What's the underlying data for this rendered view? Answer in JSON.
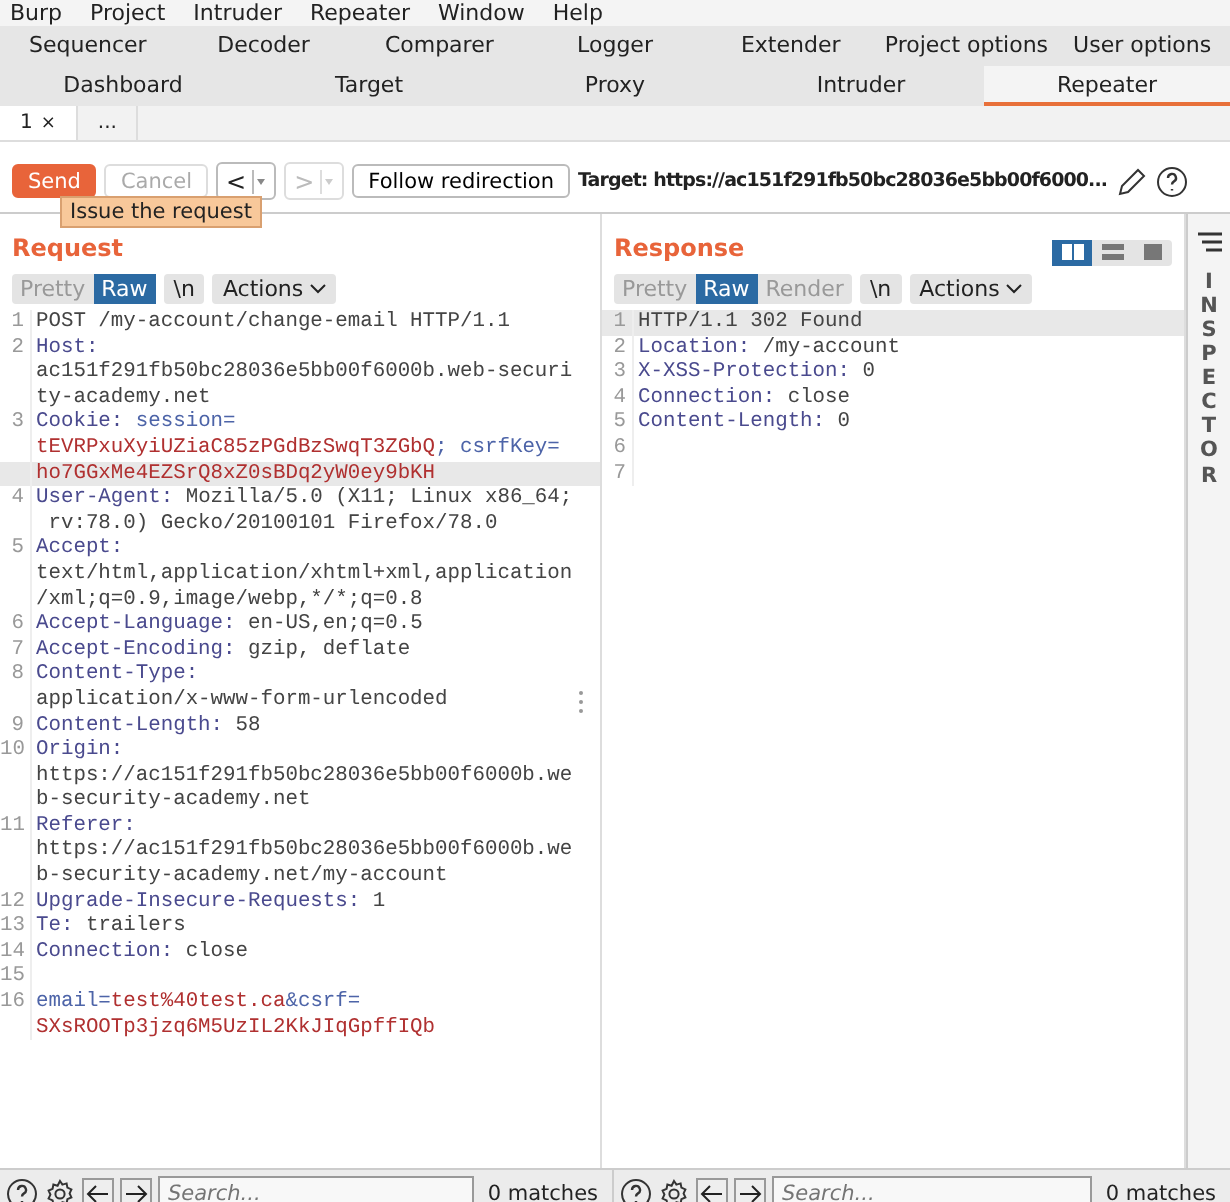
{
  "menu": [
    "Burp",
    "Project",
    "Intruder",
    "Repeater",
    "Window",
    "Help"
  ],
  "tabs_row_1": [
    {
      "label": "Sequencer",
      "selected": false
    },
    {
      "label": "Decoder",
      "selected": false
    },
    {
      "label": "Comparer",
      "selected": false
    },
    {
      "label": "Logger",
      "selected": false
    },
    {
      "label": "Extender",
      "selected": false
    },
    {
      "label": "Project options",
      "selected": false
    },
    {
      "label": "User options",
      "selected": false
    }
  ],
  "tabs_row_2": [
    {
      "label": "Dashboard",
      "selected": false
    },
    {
      "label": "Target",
      "selected": false
    },
    {
      "label": "Proxy",
      "selected": false
    },
    {
      "label": "Intruder",
      "selected": false
    },
    {
      "label": "Repeater",
      "selected": true
    }
  ],
  "repeater_tabs": [
    {
      "label": "1",
      "close": "×",
      "selected": true
    },
    {
      "label": "...",
      "selected": false
    }
  ],
  "toolbar": {
    "send": "Send",
    "cancel": "Cancel",
    "back": "<",
    "forward": ">",
    "follow": "Follow redirection",
    "target": "Target: https://ac151f291fb50bc28036e5bb00f6000...",
    "tooltip": "Issue the request"
  },
  "request": {
    "title": "Request",
    "views": [
      {
        "label": "Pretty",
        "selected": false
      },
      {
        "label": "Raw",
        "selected": true
      }
    ],
    "newline": "\\n",
    "actions": "Actions",
    "lines": [
      {
        "number": "1",
        "highlighted": false,
        "rows": [
          {
            "parts": [
              {
                "text": "POST /my-account/change-email HTTP/1.1",
                "kind": "plain"
              }
            ]
          }
        ]
      },
      {
        "number": "2",
        "highlighted": false,
        "rows": [
          {
            "parts": [
              {
                "text": "Host:",
                "kind": "key"
              }
            ]
          },
          {
            "parts": [
              {
                "text": "ac151f291fb50bc28036e5bb00f6000b.web-securi",
                "kind": "plain"
              }
            ]
          },
          {
            "parts": [
              {
                "text": "ty-academy.net",
                "kind": "plain"
              }
            ]
          }
        ]
      },
      {
        "number": "3",
        "highlighted": true,
        "rows": [
          {
            "parts": [
              {
                "text": "Cookie:",
                "kind": "key"
              },
              {
                "text": " session=",
                "kind": "param"
              }
            ]
          },
          {
            "parts": [
              {
                "text": "tEVRPxuXyiUZiaC85zPGdBzSwqT3ZGbQ",
                "kind": "value"
              },
              {
                "text": "; csrfKey=",
                "kind": "param"
              }
            ]
          },
          {
            "parts": [
              {
                "text": "ho7GGxMe4EZSrQ8xZ0sBDq2yW0ey9bKH",
                "kind": "value"
              }
            ]
          }
        ]
      },
      {
        "number": "4",
        "highlighted": false,
        "rows": [
          {
            "parts": [
              {
                "text": "User-Agent:",
                "kind": "key"
              },
              {
                "text": " Mozilla/5.0 (X11; Linux x86_64;",
                "kind": "plain"
              }
            ]
          },
          {
            "parts": [
              {
                "text": " rv:78.0) Gecko/20100101 Firefox/78.0",
                "kind": "plain"
              }
            ]
          }
        ]
      },
      {
        "number": "5",
        "highlighted": false,
        "rows": [
          {
            "parts": [
              {
                "text": "Accept:",
                "kind": "key"
              }
            ]
          },
          {
            "parts": [
              {
                "text": "text/html,application/xhtml+xml,application",
                "kind": "plain"
              }
            ]
          },
          {
            "parts": [
              {
                "text": "/xml;q=0.9,image/webp,*/*;q=0.8",
                "kind": "plain"
              }
            ]
          }
        ]
      },
      {
        "number": "6",
        "highlighted": false,
        "rows": [
          {
            "parts": [
              {
                "text": "Accept-Language:",
                "kind": "key"
              },
              {
                "text": " en-US,en;q=0.5",
                "kind": "plain"
              }
            ]
          }
        ]
      },
      {
        "number": "7",
        "highlighted": false,
        "rows": [
          {
            "parts": [
              {
                "text": "Accept-Encoding:",
                "kind": "key"
              },
              {
                "text": " gzip, deflate",
                "kind": "plain"
              }
            ]
          }
        ]
      },
      {
        "number": "8",
        "highlighted": false,
        "rows": [
          {
            "parts": [
              {
                "text": "Content-Type:",
                "kind": "key"
              }
            ]
          },
          {
            "parts": [
              {
                "text": "application/x-www-form-urlencoded",
                "kind": "plain"
              }
            ]
          }
        ]
      },
      {
        "number": "9",
        "highlighted": false,
        "rows": [
          {
            "parts": [
              {
                "text": "Content-Length:",
                "kind": "key"
              },
              {
                "text": " 58",
                "kind": "plain"
              }
            ]
          }
        ]
      },
      {
        "number": "10",
        "highlighted": false,
        "rows": [
          {
            "parts": [
              {
                "text": "Origin:",
                "kind": "key"
              }
            ]
          },
          {
            "parts": [
              {
                "text": "https://ac151f291fb50bc28036e5bb00f6000b.we",
                "kind": "plain"
              }
            ]
          },
          {
            "parts": [
              {
                "text": "b-security-academy.net",
                "kind": "plain"
              }
            ]
          }
        ]
      },
      {
        "number": "11",
        "highlighted": false,
        "rows": [
          {
            "parts": [
              {
                "text": "Referer:",
                "kind": "key"
              }
            ]
          },
          {
            "parts": [
              {
                "text": "https://ac151f291fb50bc28036e5bb00f6000b.we",
                "kind": "plain"
              }
            ]
          },
          {
            "parts": [
              {
                "text": "b-security-academy.net/my-account",
                "kind": "plain"
              }
            ]
          }
        ]
      },
      {
        "number": "12",
        "highlighted": false,
        "rows": [
          {
            "parts": [
              {
                "text": "Upgrade-Insecure-Requests:",
                "kind": "key"
              },
              {
                "text": " 1",
                "kind": "plain"
              }
            ]
          }
        ]
      },
      {
        "number": "13",
        "highlighted": false,
        "rows": [
          {
            "parts": [
              {
                "text": "Te:",
                "kind": "key"
              },
              {
                "text": " trailers",
                "kind": "plain"
              }
            ]
          }
        ]
      },
      {
        "number": "14",
        "highlighted": false,
        "rows": [
          {
            "parts": [
              {
                "text": "Connection:",
                "kind": "key"
              },
              {
                "text": " close",
                "kind": "plain"
              }
            ]
          }
        ]
      },
      {
        "number": "15",
        "highlighted": false,
        "rows": [
          {}
        ]
      },
      {
        "number": "16",
        "highlighted": false,
        "rows": [
          {
            "parts": [
              {
                "text": "email=",
                "kind": "param"
              },
              {
                "text": "test%40test.ca",
                "kind": "value"
              },
              {
                "text": "&csrf=",
                "kind": "param"
              }
            ]
          },
          {
            "parts": [
              {
                "text": "SXsROOTp3jzq6M5UzIL2KkJIqGpffIQb",
                "kind": "value"
              }
            ]
          }
        ]
      }
    ],
    "search": {
      "placeholder": "Search...",
      "matches": "0 matches"
    }
  },
  "response": {
    "title": "Response",
    "views": [
      {
        "label": "Pretty",
        "selected": false
      },
      {
        "label": "Raw",
        "selected": true
      },
      {
        "label": "Render",
        "selected": false
      }
    ],
    "newline": "\\n",
    "actions": "Actions",
    "layouts": [
      {
        "selected": true
      },
      {
        "selected": false
      },
      {
        "selected": false
      }
    ],
    "lines": [
      {
        "number": "1",
        "highlighted": true,
        "rows": [
          {
            "parts": [
              {
                "text": "HTTP/1.1 302 Found",
                "kind": "plain"
              }
            ]
          }
        ]
      },
      {
        "number": "2",
        "highlighted": false,
        "rows": [
          {
            "parts": [
              {
                "text": "Location:",
                "kind": "key"
              },
              {
                "text": " /my-account",
                "kind": "plain"
              }
            ]
          }
        ]
      },
      {
        "number": "3",
        "highlighted": false,
        "rows": [
          {
            "parts": [
              {
                "text": "X-XSS-Protection:",
                "kind": "key"
              },
              {
                "text": " 0",
                "kind": "plain"
              }
            ]
          }
        ]
      },
      {
        "number": "4",
        "highlighted": false,
        "rows": [
          {
            "parts": [
              {
                "text": "Connection:",
                "kind": "key"
              },
              {
                "text": " close",
                "kind": "plain"
              }
            ]
          }
        ]
      },
      {
        "number": "5",
        "highlighted": false,
        "rows": [
          {
            "parts": [
              {
                "text": "Content-Length:",
                "kind": "key"
              },
              {
                "text": " 0",
                "kind": "plain"
              }
            ]
          }
        ]
      },
      {
        "number": "6",
        "highlighted": false,
        "rows": [
          {}
        ]
      },
      {
        "number": "7",
        "highlighted": false,
        "rows": [
          {}
        ]
      }
    ],
    "search": {
      "placeholder": "Search...",
      "matches": "0 matches"
    }
  },
  "inspector": {
    "label": "INSPECTOR"
  }
}
